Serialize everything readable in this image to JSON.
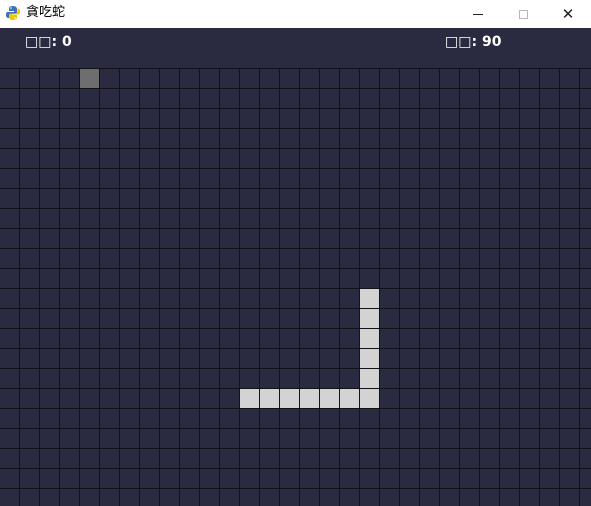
{
  "window": {
    "title": "貪吃蛇",
    "icon": "python-snake-icon",
    "controls": {
      "minimize": "minimize-icon",
      "maximize": "maximize-icon",
      "close": "close-icon"
    },
    "close_glyph": "✕"
  },
  "hud": {
    "score_label": "□□",
    "score_value": "0",
    "speed_label": "□□",
    "speed_value": "90"
  },
  "game": {
    "grid_cols": 30,
    "grid_rows": 22,
    "food": {
      "col": 4,
      "row": 0
    },
    "snake": [
      {
        "col": 18,
        "row": 11
      },
      {
        "col": 18,
        "row": 12
      },
      {
        "col": 18,
        "row": 13
      },
      {
        "col": 18,
        "row": 14
      },
      {
        "col": 18,
        "row": 15
      },
      {
        "col": 18,
        "row": 16
      },
      {
        "col": 17,
        "row": 16
      },
      {
        "col": 16,
        "row": 16
      },
      {
        "col": 15,
        "row": 16
      },
      {
        "col": 14,
        "row": 16
      },
      {
        "col": 13,
        "row": 16
      },
      {
        "col": 12,
        "row": 16
      }
    ]
  },
  "colors": {
    "background": "#2a2b40",
    "grid_line": "#111118",
    "snake": "#d3d3d3",
    "food": "#6e6e6e",
    "hud_text": "#ffffff"
  }
}
